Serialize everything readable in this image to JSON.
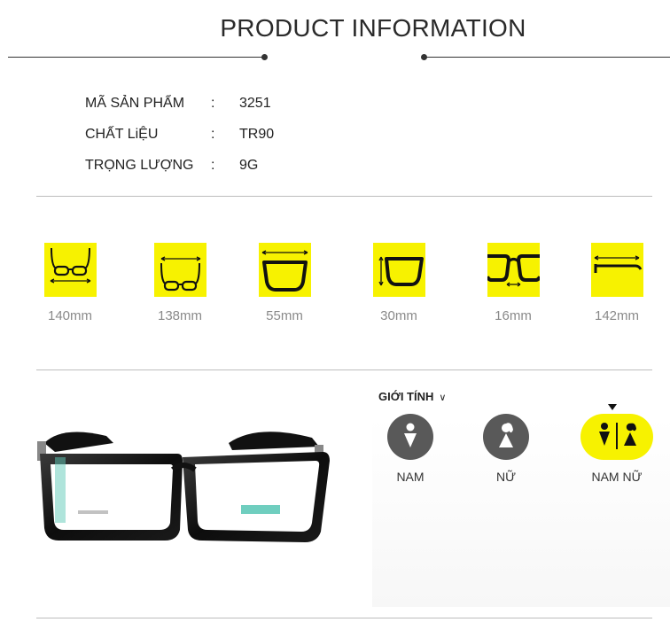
{
  "header": {
    "title": "PRODUCT INFORMATION"
  },
  "specs": [
    {
      "label": "MÃ SẢN PHẨM",
      "colon": ":",
      "value": "3251"
    },
    {
      "label": "CHẤT LiỆU",
      "colon": ":",
      "value": "TR90"
    },
    {
      "label": "TRỌNG LƯỢNG",
      "colon": ":",
      "value": "9G"
    }
  ],
  "measurements": [
    {
      "icon": "frame-width-top-icon",
      "value": "140mm"
    },
    {
      "icon": "frame-width-bottom-icon",
      "value": "138mm"
    },
    {
      "icon": "lens-width-icon",
      "value": "55mm"
    },
    {
      "icon": "lens-height-icon",
      "value": "30mm"
    },
    {
      "icon": "bridge-width-icon",
      "value": "16mm"
    },
    {
      "icon": "temple-length-icon",
      "value": "142mm"
    }
  ],
  "gender": {
    "title": "GIỚI TÍNH",
    "options": [
      {
        "label": "NAM",
        "icon": "male-icon",
        "selected": false
      },
      {
        "label": "NỮ",
        "icon": "female-icon",
        "selected": false
      },
      {
        "label": "NAM NỮ",
        "icon": "unisex-icon",
        "selected": true
      }
    ]
  },
  "colors": {
    "accent": "#f7f200",
    "icon_dark": "#595959"
  }
}
